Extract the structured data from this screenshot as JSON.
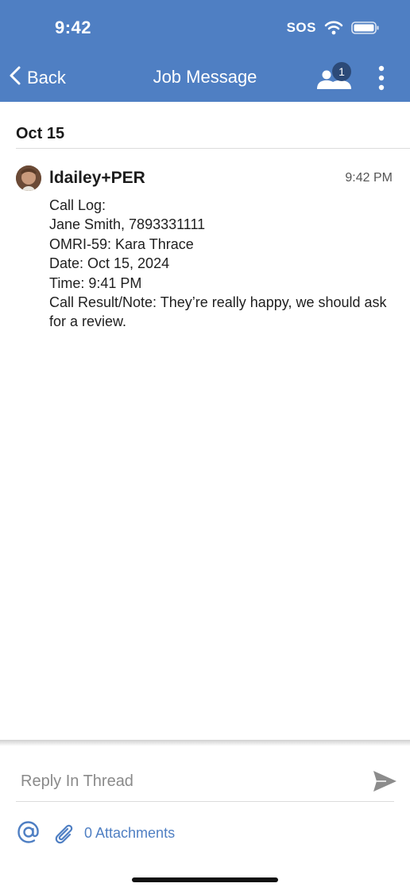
{
  "status_bar": {
    "time": "9:42",
    "sos": "SOS"
  },
  "nav": {
    "back_label": "Back",
    "title": "Job Message",
    "participants_count": "1"
  },
  "thread": {
    "date_header": "Oct 15",
    "message": {
      "sender": "ldailey+PER",
      "time": "9:42 PM",
      "lines": [
        "Call Log:",
        "Jane Smith, 7893331111",
        "OMRI-59: Kara Thrace",
        "Date: Oct 15, 2024",
        "Time: 9:41 PM",
        "Call Result/Note: They’re really happy, we should ask for a review."
      ]
    }
  },
  "composer": {
    "placeholder": "Reply In Thread",
    "value": "",
    "attachments_label": "0 Attachments"
  },
  "colors": {
    "brand": "#4f7fc3",
    "badge": "#2c4a78"
  },
  "icons": [
    "chevron-left-icon",
    "participants-icon",
    "more-vertical-icon",
    "wifi-icon",
    "battery-icon",
    "send-icon",
    "at-sign-icon",
    "paperclip-icon"
  ]
}
